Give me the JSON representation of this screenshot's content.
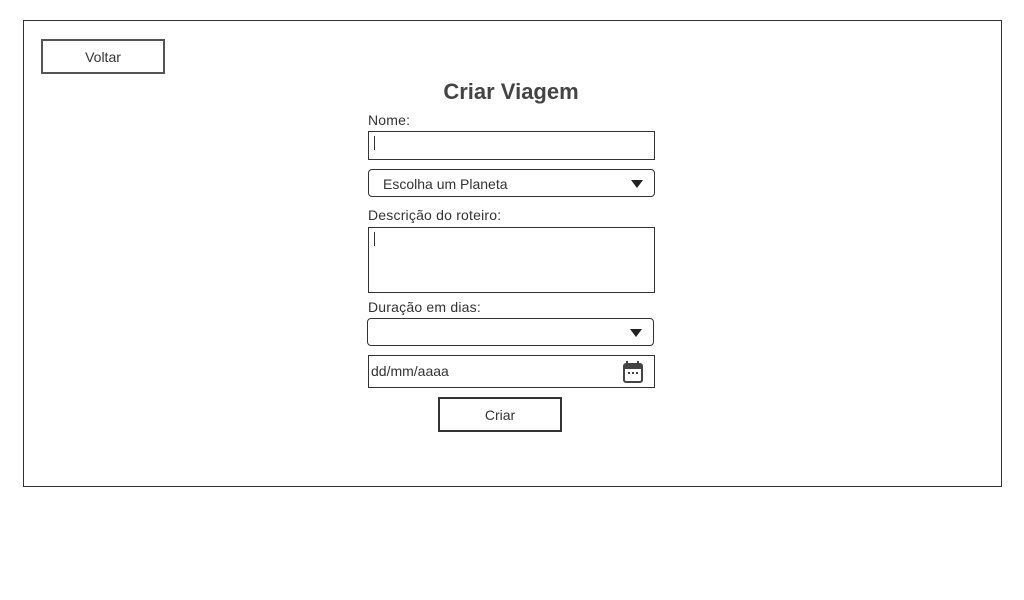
{
  "header": {
    "back_label": "Voltar",
    "title": "Criar Viagem"
  },
  "form": {
    "name_label": "Nome:",
    "name_value": "",
    "planet_select": "Escolha um Planeta",
    "description_label": "Descrição do roteiro:",
    "description_value": "",
    "duration_label": "Duração em dias:",
    "duration_value": "",
    "date_placeholder": "dd/mm/aaaa",
    "submit_label": "Criar"
  },
  "icons": {
    "calendar": "calendar-icon",
    "dropdown": "chevron-down-icon"
  },
  "colors": {
    "border": "#333333",
    "text": "#333333",
    "title": "#444444",
    "background": "#ffffff"
  }
}
